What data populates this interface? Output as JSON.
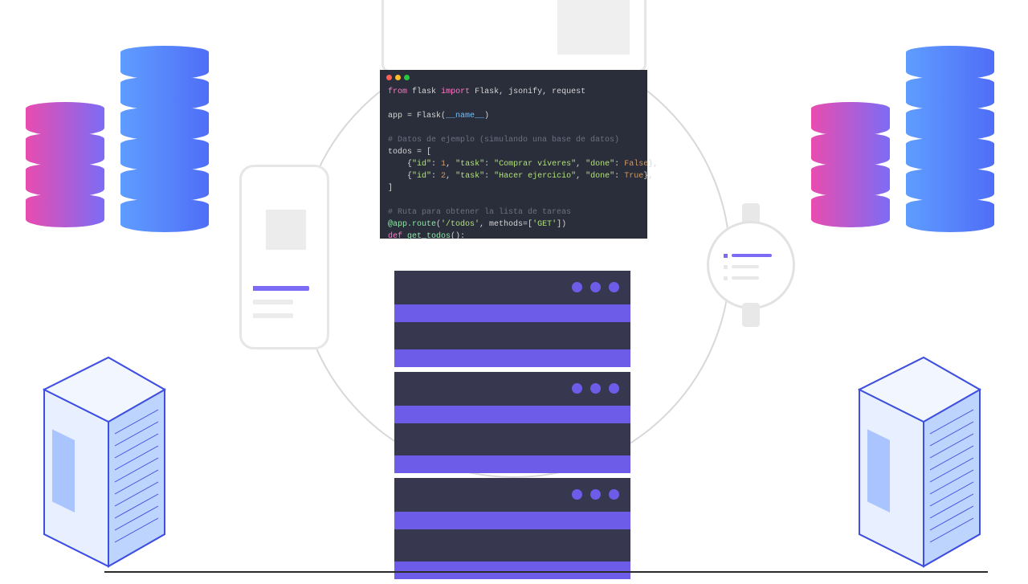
{
  "diagram": {
    "devices": [
      "browser",
      "phone",
      "watch"
    ],
    "center": "server-stack",
    "sides": [
      "database-cylinders",
      "server-rack"
    ]
  },
  "code": {
    "language": "python",
    "line1_from": "from",
    "line1_module": "flask",
    "line1_import": "import",
    "line1_names": "Flask, jsonify, request",
    "line3_left": "app = Flask(",
    "line3_arg": "__name__",
    "line3_right": ")",
    "line5_comment": "# Datos de ejemplo (simulando una base de datos)",
    "line6": "todos = [",
    "line7_a": "    {",
    "line7_id_k": "\"id\"",
    "line7_id_v": "1",
    "line7_task_k": "\"task\"",
    "line7_task_v": "\"Comprar víveres\"",
    "line7_done_k": "\"done\"",
    "line7_done_v": "False",
    "line7_z": "},",
    "line8_a": "    {",
    "line8_id_v": "2",
    "line8_task_v": "\"Hacer ejercicio\"",
    "line8_done_v": "True",
    "line8_z": "},",
    "line9": "]",
    "line11_comment": "# Ruta para obtener la lista de tareas",
    "line12_dec": "@app.route",
    "line12_args_a": "(",
    "line12_route": "'/todos'",
    "line12_sep": ", methods=[",
    "line12_method": "'GET'",
    "line12_args_z": "])",
    "line13_def": "def",
    "line13_name": "get_todos",
    "line13_paren": "():"
  }
}
